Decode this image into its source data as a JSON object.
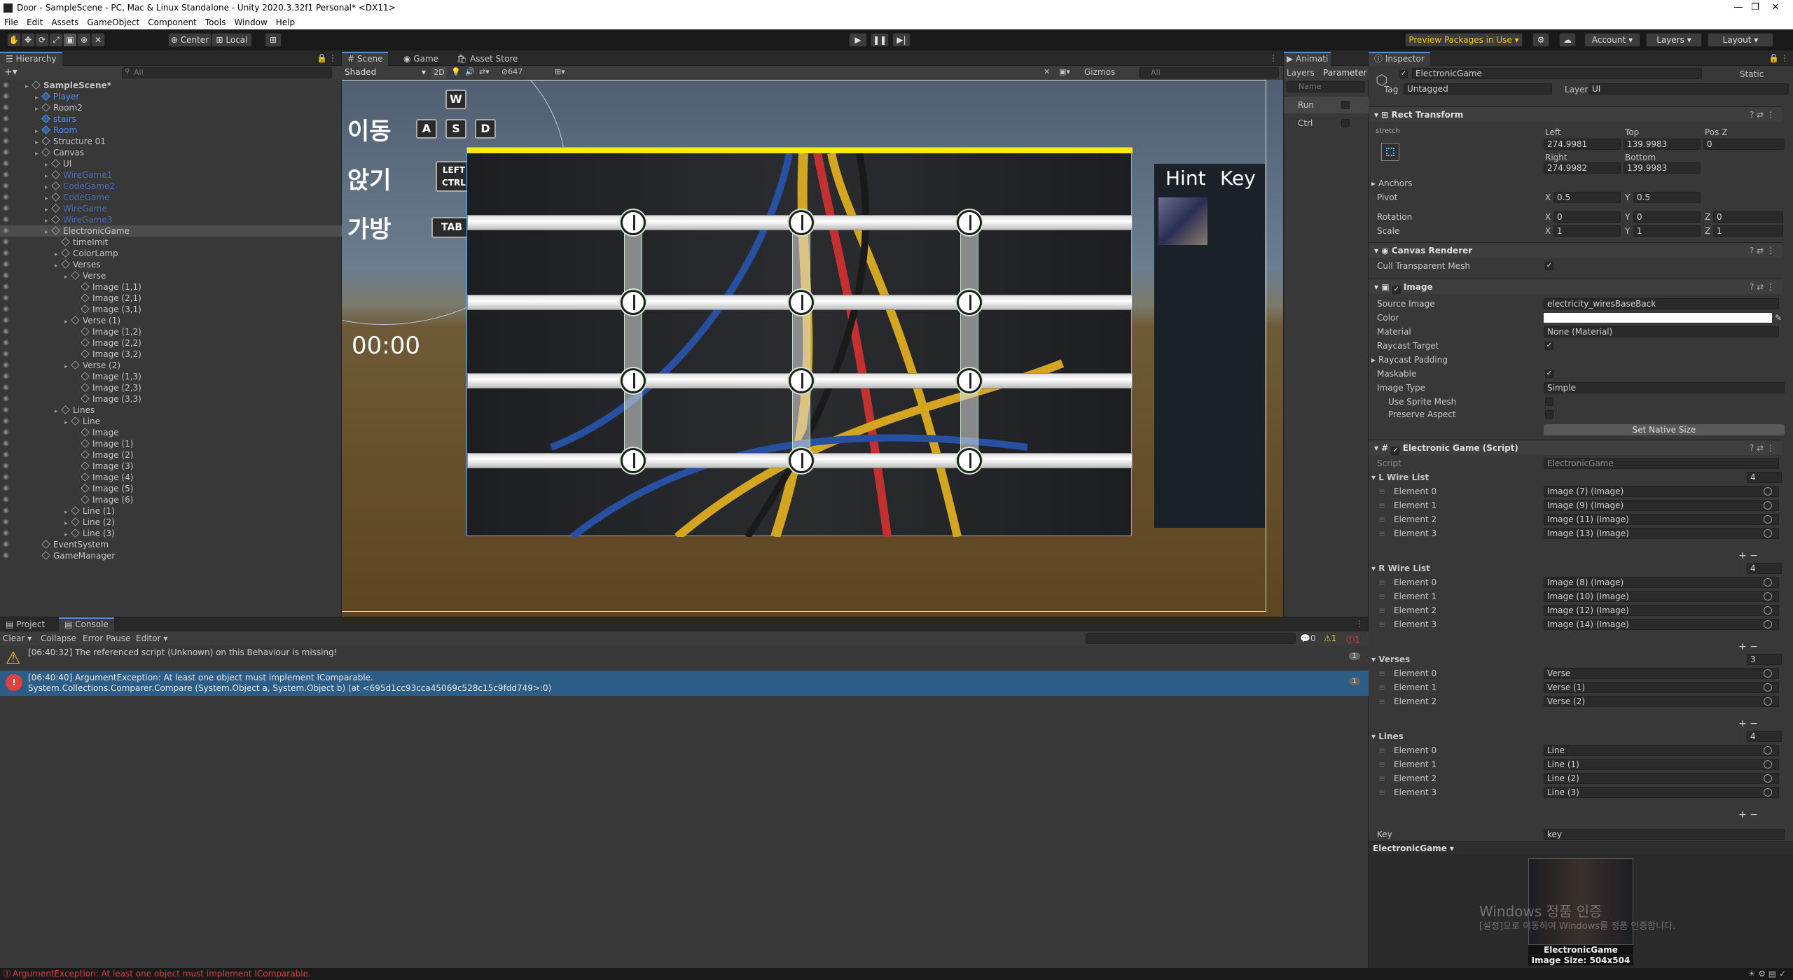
{
  "window": {
    "title": "Door - SampleScene - PC, Mac & Linux Standalone - Unity 2020.3.32f1 Personal* <DX11>",
    "minimize": "—",
    "maximize": "❐",
    "close": "✕"
  },
  "menu": [
    "File",
    "Edit",
    "Assets",
    "GameObject",
    "Component",
    "Tools",
    "Window",
    "Help"
  ],
  "toolbar": {
    "center": "Center",
    "local": "Local",
    "preview_packages": "Preview Packages in Use",
    "account": "Account",
    "layers": "Layers",
    "layout": "Layout"
  },
  "hierarchy": {
    "tab": "Hierarchy",
    "search": "All",
    "rows": [
      {
        "label": "SampleScene*",
        "indent": 0,
        "style": "scene"
      },
      {
        "label": "Player",
        "indent": 1,
        "style": "blue"
      },
      {
        "label": "Room2",
        "indent": 1,
        "style": "normal"
      },
      {
        "label": "stairs",
        "indent": 1,
        "style": "blue"
      },
      {
        "label": "Room",
        "indent": 1,
        "style": "blue"
      },
      {
        "label": "Structure 01",
        "indent": 1,
        "style": "normal"
      },
      {
        "label": "Canvas",
        "indent": 1,
        "style": "normal"
      },
      {
        "label": "UI",
        "indent": 2,
        "style": "normal"
      },
      {
        "label": "WireGame1",
        "indent": 2,
        "style": "dim"
      },
      {
        "label": "CodeGame2",
        "indent": 2,
        "style": "dim"
      },
      {
        "label": "CodeGame",
        "indent": 2,
        "style": "dim"
      },
      {
        "label": "WireGame",
        "indent": 2,
        "style": "dim"
      },
      {
        "label": "WireGame3",
        "indent": 2,
        "style": "dim"
      },
      {
        "label": "ElectronicGame",
        "indent": 2,
        "style": "selected"
      },
      {
        "label": "timeImit",
        "indent": 3,
        "style": "normal"
      },
      {
        "label": "ColorLamp",
        "indent": 3,
        "style": "normal"
      },
      {
        "label": "Verses",
        "indent": 3,
        "style": "normal"
      },
      {
        "label": "Verse",
        "indent": 4,
        "style": "normal"
      },
      {
        "label": "Image (1,1)",
        "indent": 5,
        "style": "normal"
      },
      {
        "label": "Image (2,1)",
        "indent": 5,
        "style": "normal"
      },
      {
        "label": "Image (3,1)",
        "indent": 5,
        "style": "normal"
      },
      {
        "label": "Verse (1)",
        "indent": 4,
        "style": "normal"
      },
      {
        "label": "Image (1,2)",
        "indent": 5,
        "style": "normal"
      },
      {
        "label": "Image (2,2)",
        "indent": 5,
        "style": "normal"
      },
      {
        "label": "Image (3,2)",
        "indent": 5,
        "style": "normal"
      },
      {
        "label": "Verse (2)",
        "indent": 4,
        "style": "normal"
      },
      {
        "label": "Image (1,3)",
        "indent": 5,
        "style": "normal"
      },
      {
        "label": "Image (2,3)",
        "indent": 5,
        "style": "normal"
      },
      {
        "label": "Image (3,3)",
        "indent": 5,
        "style": "normal"
      },
      {
        "label": "Lines",
        "indent": 3,
        "style": "normal"
      },
      {
        "label": "Line",
        "indent": 4,
        "style": "normal"
      },
      {
        "label": "Image",
        "indent": 5,
        "style": "normal"
      },
      {
        "label": "Image (1)",
        "indent": 5,
        "style": "normal"
      },
      {
        "label": "Image (2)",
        "indent": 5,
        "style": "normal"
      },
      {
        "label": "Image (3)",
        "indent": 5,
        "style": "normal"
      },
      {
        "label": "Image (4)",
        "indent": 5,
        "style": "normal"
      },
      {
        "label": "Image (5)",
        "indent": 5,
        "style": "normal"
      },
      {
        "label": "Image (6)",
        "indent": 5,
        "style": "normal"
      },
      {
        "label": "Line (1)",
        "indent": 4,
        "style": "normal"
      },
      {
        "label": "Line (2)",
        "indent": 4,
        "style": "normal"
      },
      {
        "label": "Line (3)",
        "indent": 4,
        "style": "normal"
      },
      {
        "label": "EventSystem",
        "indent": 1,
        "style": "normal"
      },
      {
        "label": "GameManager",
        "indent": 1,
        "style": "normal"
      }
    ]
  },
  "scene": {
    "tabs": [
      "Scene",
      "Game",
      "Asset Store"
    ],
    "shading": "Shaded",
    "mode2d": "2D",
    "hidden_count": "647",
    "gizmos": "Gizmos",
    "search": "All",
    "move_label": "이동",
    "sit_label": "앉기",
    "bag_label": "가방",
    "keys": {
      "w": "W",
      "a": "A",
      "s": "S",
      "d": "D",
      "ctrl": "LEFT CTRL",
      "tab": "TAB"
    },
    "timer": "00:00",
    "hint": "Hint",
    "key": "Key"
  },
  "animator": {
    "tab": "Animati",
    "layers_tab": "Layers",
    "params_tab": "Parameter",
    "search": "Name",
    "params": [
      "Run",
      "Ctrl"
    ]
  },
  "inspector": {
    "tab": "Inspector",
    "object_name": "ElectronicGame",
    "static_label": "Static",
    "tag_label": "Tag",
    "tag_value": "Untagged",
    "layer_label": "Layer",
    "layer_value": "UI",
    "rect_transform": {
      "title": "Rect Transform",
      "stretch": "stretch",
      "left_label": "Left",
      "left": "274.9981",
      "top_label": "Top",
      "top": "139.9983",
      "posz_label": "Pos Z",
      "posz": "0",
      "right_label": "Right",
      "right": "274.9982",
      "bottom_label": "Bottom",
      "bottom": "139.9983",
      "anchors": "Anchors",
      "pivot_label": "Pivot",
      "pivot_x": "0.5",
      "pivot_y": "0.5",
      "rotation_label": "Rotation",
      "rot_x": "0",
      "rot_y": "0",
      "rot_z": "0",
      "scale_label": "Scale",
      "scale_x": "1",
      "scale_y": "1",
      "scale_z": "1"
    },
    "canvas_renderer": {
      "title": "Canvas Renderer",
      "cull": "Cull Transparent Mesh"
    },
    "image": {
      "title": "Image",
      "source_label": "Source Image",
      "source": "electricity_wiresBaseBack",
      "color_label": "Color",
      "material_label": "Material",
      "material": "None (Material)",
      "raycast_target": "Raycast Target",
      "raycast_padding": "Raycast Padding",
      "maskable": "Maskable",
      "image_type_label": "Image Type",
      "image_type": "Simple",
      "use_sprite_mesh": "Use Sprite Mesh",
      "preserve_aspect": "Preserve Aspect",
      "set_native": "Set Native Size"
    },
    "script": {
      "title": "Electronic Game (Script)",
      "script_label": "Script",
      "script_value": "ElectronicGame",
      "l_wire_label": "L Wire List",
      "l_wire_count": "4",
      "l_wire": [
        {
          "el": "Element 0",
          "val": "Image (7) (Image)"
        },
        {
          "el": "Element 1",
          "val": "Image (9) (Image)"
        },
        {
          "el": "Element 2",
          "val": "Image (11) (Image)"
        },
        {
          "el": "Element 3",
          "val": "Image (13) (Image)"
        }
      ],
      "r_wire_label": "R Wire List",
      "r_wire_count": "4",
      "r_wire": [
        {
          "el": "Element 0",
          "val": "Image (8) (Image)"
        },
        {
          "el": "Element 1",
          "val": "Image (10) (Image)"
        },
        {
          "el": "Element 2",
          "val": "Image (12) (Image)"
        },
        {
          "el": "Element 3",
          "val": "Image (14) (Image)"
        }
      ],
      "verses_label": "Verses",
      "verses_count": "3",
      "verses": [
        {
          "el": "Element 0",
          "val": "Verse"
        },
        {
          "el": "Element 1",
          "val": "Verse (1)"
        },
        {
          "el": "Element 2",
          "val": "Verse (2)"
        }
      ],
      "lines_label": "Lines",
      "lines_count": "4",
      "lines": [
        {
          "el": "Element 0",
          "val": "Line"
        },
        {
          "el": "Element 1",
          "val": "Line (1)"
        },
        {
          "el": "Element 2",
          "val": "Line (2)"
        },
        {
          "el": "Element 3",
          "val": "Line (3)"
        }
      ],
      "key_label": "Key",
      "key_value": "key"
    },
    "preview_name": "ElectronicGame",
    "preview_caption": "ElectronicGame",
    "preview_size": "Image Size: 504x504",
    "watermark1": "Windows 정품 인증",
    "watermark2": "[설정]으로 이동하여 Windows를 정품 인증합니다."
  },
  "console": {
    "tabs": [
      "Project",
      "Console"
    ],
    "clear": "Clear",
    "collapse": "Collapse",
    "error_pause": "Error Pause",
    "editor": "Editor",
    "count_log": "0",
    "count_warn": "1",
    "count_err": "1",
    "messages": [
      {
        "type": "warning",
        "line1": "[06:40:32] The referenced script (Unknown) on this Behaviour is missing!",
        "line2": "",
        "count": "1"
      },
      {
        "type": "error",
        "line1": "[06:40:40] ArgumentException: At least one object must implement IComparable.",
        "line2": "System.Collections.Comparer.Compare (System.Object a, System.Object b) (at <695d1cc93cca45069c528c15c9fdd749>:0)",
        "count": "1"
      }
    ]
  },
  "status": "ArgumentException: At least one object must implement IComparable."
}
